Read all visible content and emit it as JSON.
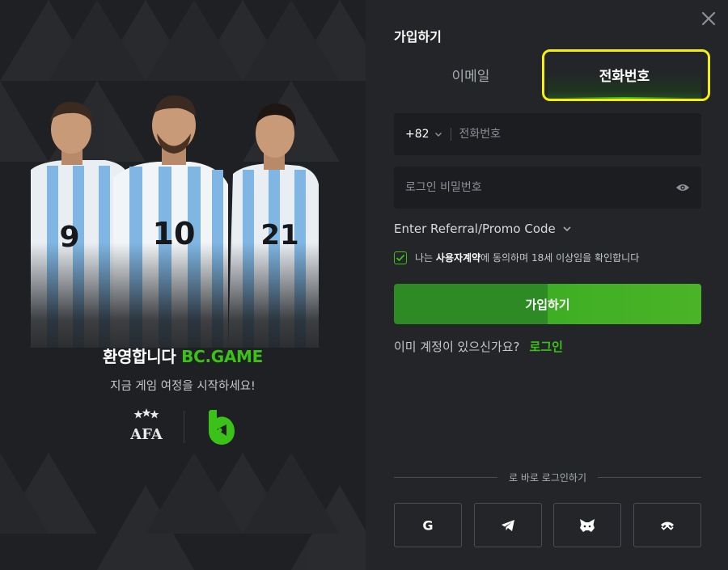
{
  "left": {
    "welcome_text": "환영합니다",
    "brand": "BC.GAME",
    "subtitle": "지금 게임 여정을 시작하세요!",
    "afa_logo_text": "AFA",
    "player_numbers": [
      "9",
      "10",
      "21"
    ]
  },
  "form": {
    "title": "가입하기",
    "tabs": [
      {
        "label": "이메일",
        "active": false
      },
      {
        "label": "전화번호",
        "active": true
      }
    ],
    "phone": {
      "country_code": "+82",
      "placeholder": "전화번호"
    },
    "password": {
      "placeholder": "로그인 비밀번호"
    },
    "promo_label": "Enter Referral/Promo Code",
    "agree": {
      "prefix": "나는 ",
      "terms": "사용자계약",
      "suffix": "에 동의하며 18세 이상임을 확인합니다",
      "checked": true
    },
    "signup_button": "가입하기",
    "have_account": "이미 계정이 있으신가요?",
    "login_link": "로그인",
    "quick_login": "로 바로 로그인하기",
    "socials": [
      "google",
      "telegram",
      "metamask",
      "walletconnect"
    ],
    "socials_glyphs": {
      "google": "G"
    }
  },
  "colors": {
    "accent": "#3bc117",
    "highlight": "#f4f00a",
    "panel": "#232528",
    "input": "#1b1d20"
  }
}
